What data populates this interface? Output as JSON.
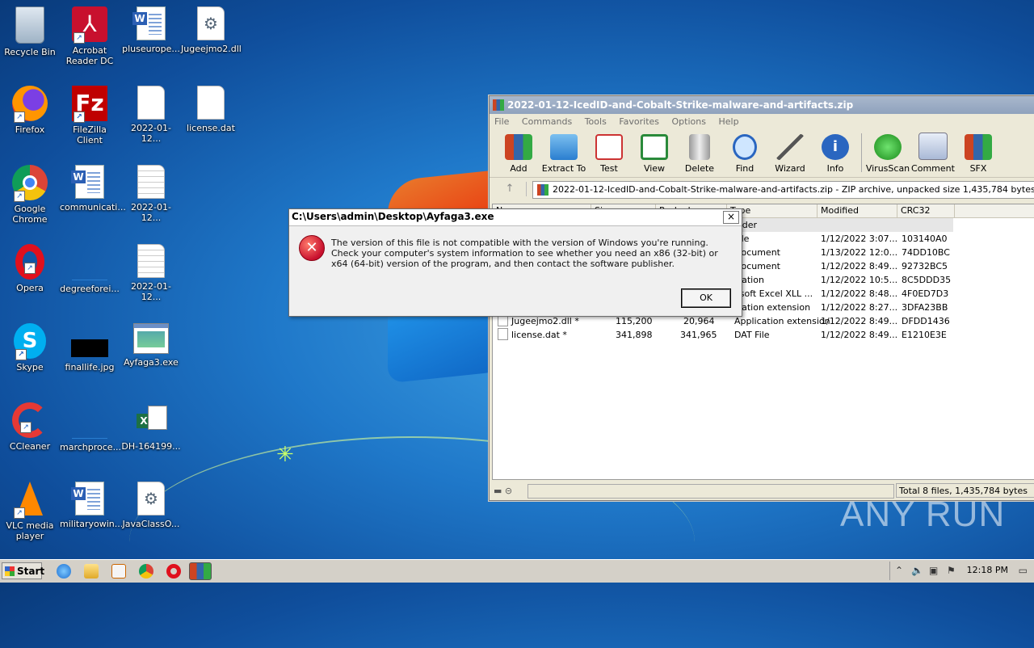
{
  "desktop": {
    "icons": [
      {
        "label": "Recycle Bin"
      },
      {
        "label": "Acrobat Reader DC"
      },
      {
        "label": "pluseurope..."
      },
      {
        "label": "Jugeejmo2.dll"
      },
      {
        "label": "Firefox"
      },
      {
        "label": "FileZilla Client"
      },
      {
        "label": "2022-01-12..."
      },
      {
        "label": "license.dat"
      },
      {
        "label": "Google Chrome"
      },
      {
        "label": "communicati..."
      },
      {
        "label": "2022-01-12..."
      },
      {
        "label": "Opera"
      },
      {
        "label": "degreeforei..."
      },
      {
        "label": "2022-01-12..."
      },
      {
        "label": "Skype"
      },
      {
        "label": "finallife.jpg"
      },
      {
        "label": "Ayfaga3.exe"
      },
      {
        "label": "CCleaner"
      },
      {
        "label": "marchproce..."
      },
      {
        "label": "DH-164199..."
      },
      {
        "label": "VLC media player"
      },
      {
        "label": "militaryowin..."
      },
      {
        "label": "JavaClassO..."
      }
    ],
    "watermark": "ANY RUN"
  },
  "winrar": {
    "title": "2022-01-12-IcedID-and-Cobalt-Strike-malware-and-artifacts.zip",
    "menu": [
      "File",
      "Commands",
      "Tools",
      "Favorites",
      "Options",
      "Help"
    ],
    "toolbar": [
      "Add",
      "Extract To",
      "Test",
      "View",
      "Delete",
      "Find",
      "Wizard",
      "Info",
      "VirusScan",
      "Comment",
      "SFX"
    ],
    "path": "2022-01-12-IcedID-and-Cobalt-Strike-malware-and-artifacts.zip - ZIP archive, unpacked size 1,435,784 bytes",
    "columns": [
      "Name",
      "Size",
      "Packed",
      "Type",
      "Modified",
      "CRC32"
    ],
    "rows": [
      {
        "name": "",
        "size": "",
        "packed": "",
        "type": "older",
        "modified": "",
        "crc": ""
      },
      {
        "name": "",
        "size": "",
        "packed": "",
        "type": "File",
        "modified": "1/12/2022 3:07...",
        "crc": "103140A0"
      },
      {
        "name": "",
        "size": "",
        "packed": "",
        "type": "Document",
        "modified": "1/13/2022 12:0...",
        "crc": "74DD10BC"
      },
      {
        "name": "",
        "size": "",
        "packed": "",
        "type": "Document",
        "modified": "1/12/2022 8:49...",
        "crc": "92732BC5"
      },
      {
        "name": "",
        "size": "",
        "packed": "",
        "type": "ication",
        "modified": "1/12/2022 10:5...",
        "crc": "8C5DDD35"
      },
      {
        "name": "",
        "size": "",
        "packed": "",
        "type": "osoft Excel XLL ...",
        "modified": "1/12/2022 8:48...",
        "crc": "4F0ED7D3"
      },
      {
        "name": "",
        "size": "",
        "packed": "",
        "type": "ication extension",
        "modified": "1/12/2022 8:27...",
        "crc": "3DFA23BB"
      },
      {
        "name": "Jugeejmo2.dll *",
        "size": "115,200",
        "packed": "20,964",
        "type": "Application extension",
        "modified": "1/12/2022 8:49...",
        "crc": "DFDD1436"
      },
      {
        "name": "license.dat *",
        "size": "341,898",
        "packed": "341,965",
        "type": "DAT File",
        "modified": "1/12/2022 8:49...",
        "crc": "E1210E3E"
      }
    ],
    "status_total": "Total 8 files, 1,435,784 bytes"
  },
  "dialog": {
    "title": "C:\\Users\\admin\\Desktop\\Ayfaga3.exe",
    "close": "×",
    "message": "The version of this file is not compatible with the version of Windows you're running. Check your computer's system information to see whether you need an x86 (32-bit) or x64 (64-bit) version of the program, and then contact the software publisher.",
    "ok_label": "OK",
    "icon_glyph": "✕"
  },
  "taskbar": {
    "start_label": "Start",
    "clock": "12:18 PM"
  }
}
